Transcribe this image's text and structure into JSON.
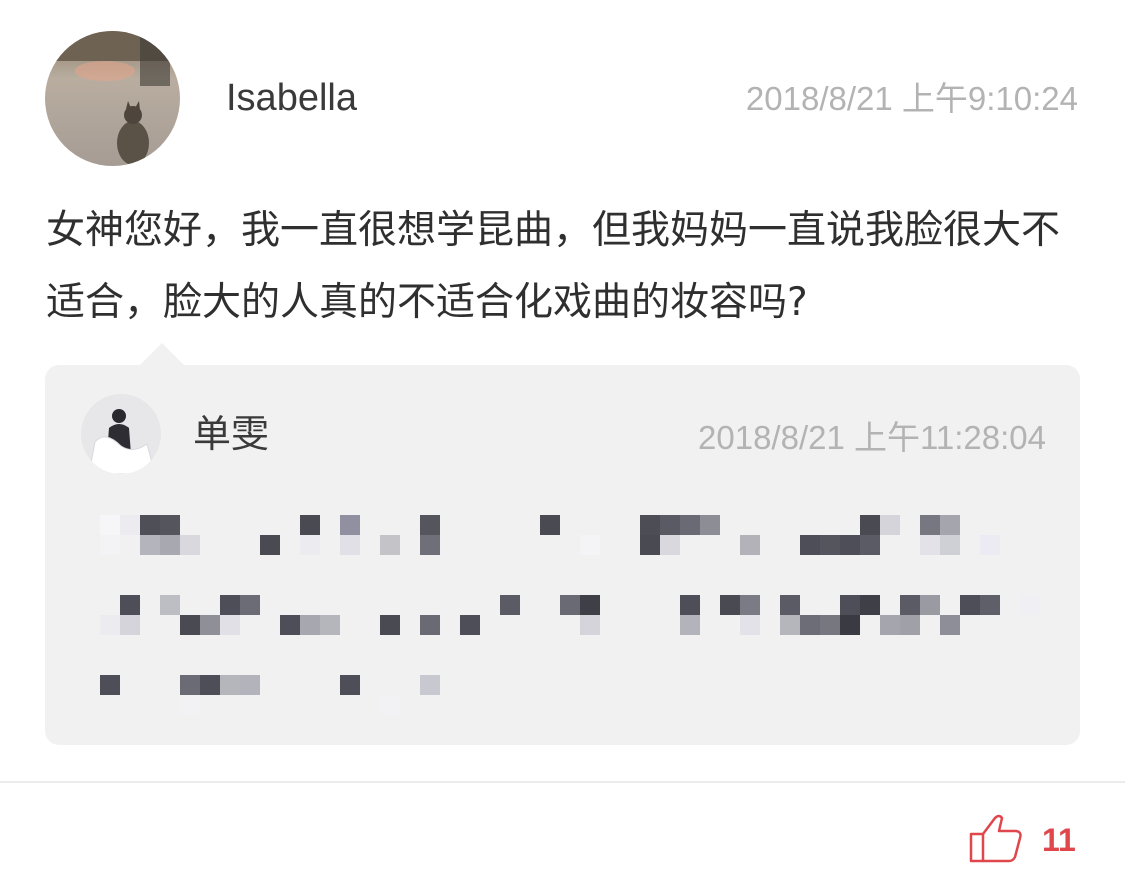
{
  "question": {
    "username": "Isabella",
    "timestamp": "2018/8/21 上午9:10:24",
    "text": "女神您好，我一直很想学昆曲，但我妈妈一直说我脸很大不适合，脸大的人真的不适合化戏曲的妆容吗?"
  },
  "reply": {
    "username": "单雯",
    "timestamp": "2018/8/21 上午11:28:04",
    "text_state": "pixelated"
  },
  "footer": {
    "like_icon": "thumbs-up-icon",
    "like_count": "11",
    "like_color": "#e0474c"
  }
}
